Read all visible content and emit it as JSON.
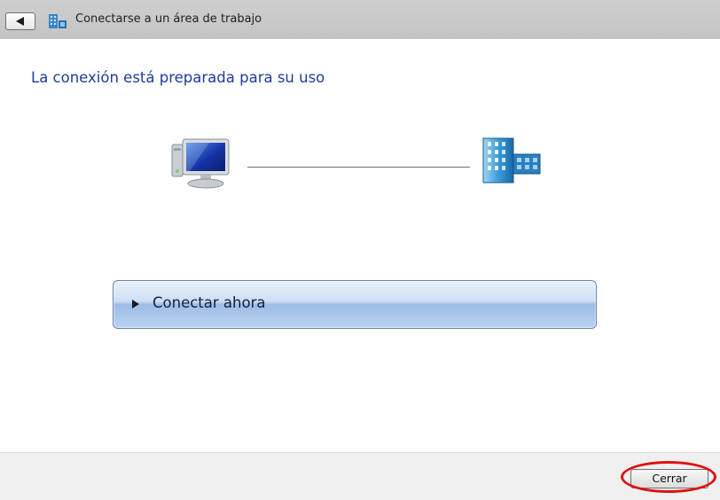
{
  "window": {
    "title": "Conectarse a un área de trabajo",
    "back_icon": "back-arrow-icon",
    "title_icon": "workplace-connection-icon"
  },
  "main": {
    "heading": "La conexión está preparada para su uso",
    "left_icon": "computer-icon",
    "right_icon": "workplace-building-icon",
    "connect_button": {
      "label": "Conectar ahora",
      "icon": "play-arrow-icon"
    }
  },
  "footer": {
    "close_label": "Cerrar"
  },
  "annotation": {
    "highlight_color": "#e01010"
  },
  "colors": {
    "heading": "#1e3c9a",
    "titlebar": "#c8c8c8",
    "footer": "#f0f0f0",
    "command_link": "#b9d3f1"
  }
}
